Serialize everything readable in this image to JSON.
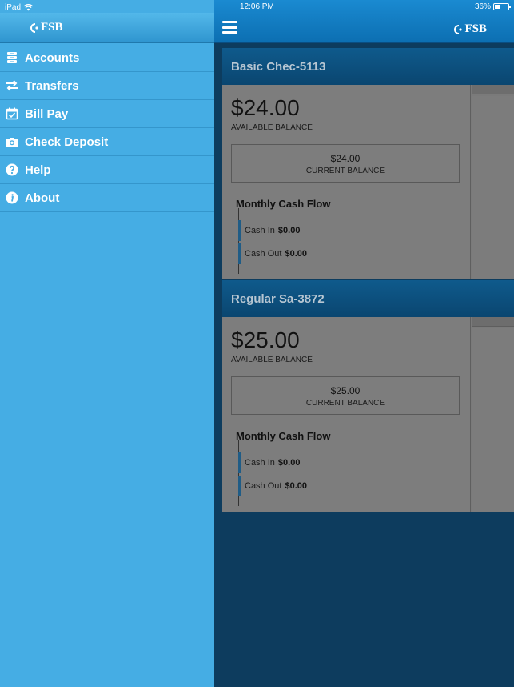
{
  "status": {
    "device": "iPad",
    "time": "12:06 PM",
    "battery": "36%"
  },
  "logo": {
    "text": "FSB"
  },
  "menu": [
    {
      "label": "Accounts",
      "icon": "accounts-icon"
    },
    {
      "label": "Transfers",
      "icon": "transfer-arrows-icon"
    },
    {
      "label": "Bill Pay",
      "icon": "calendar-check-icon"
    },
    {
      "label": "Check Deposit",
      "icon": "camera-icon"
    },
    {
      "label": "Help",
      "icon": "question-icon"
    },
    {
      "label": "About",
      "icon": "info-icon"
    }
  ],
  "accounts": [
    {
      "name": "Basic Chec-5113",
      "available_balance": "$24.00",
      "available_label": "AVAILABLE BALANCE",
      "current_balance": "$24.00",
      "current_label": "CURRENT BALANCE",
      "cash_flow_title": "Monthly Cash Flow",
      "cash_in_label": "Cash In",
      "cash_in": "$0.00",
      "cash_out_label": "Cash Out",
      "cash_out": "$0.00"
    },
    {
      "name": "Regular Sa-3872",
      "available_balance": "$25.00",
      "available_label": "AVAILABLE BALANCE",
      "current_balance": "$25.00",
      "current_label": "CURRENT BALANCE",
      "cash_flow_title": "Monthly Cash Flow",
      "cash_in_label": "Cash In",
      "cash_in": "$0.00",
      "cash_out_label": "Cash Out",
      "cash_out": "$0.00"
    }
  ],
  "colors": {
    "sidebar": "#45ade4",
    "main_bg": "#0d3c5e",
    "topbar": "#1a8ad1"
  }
}
